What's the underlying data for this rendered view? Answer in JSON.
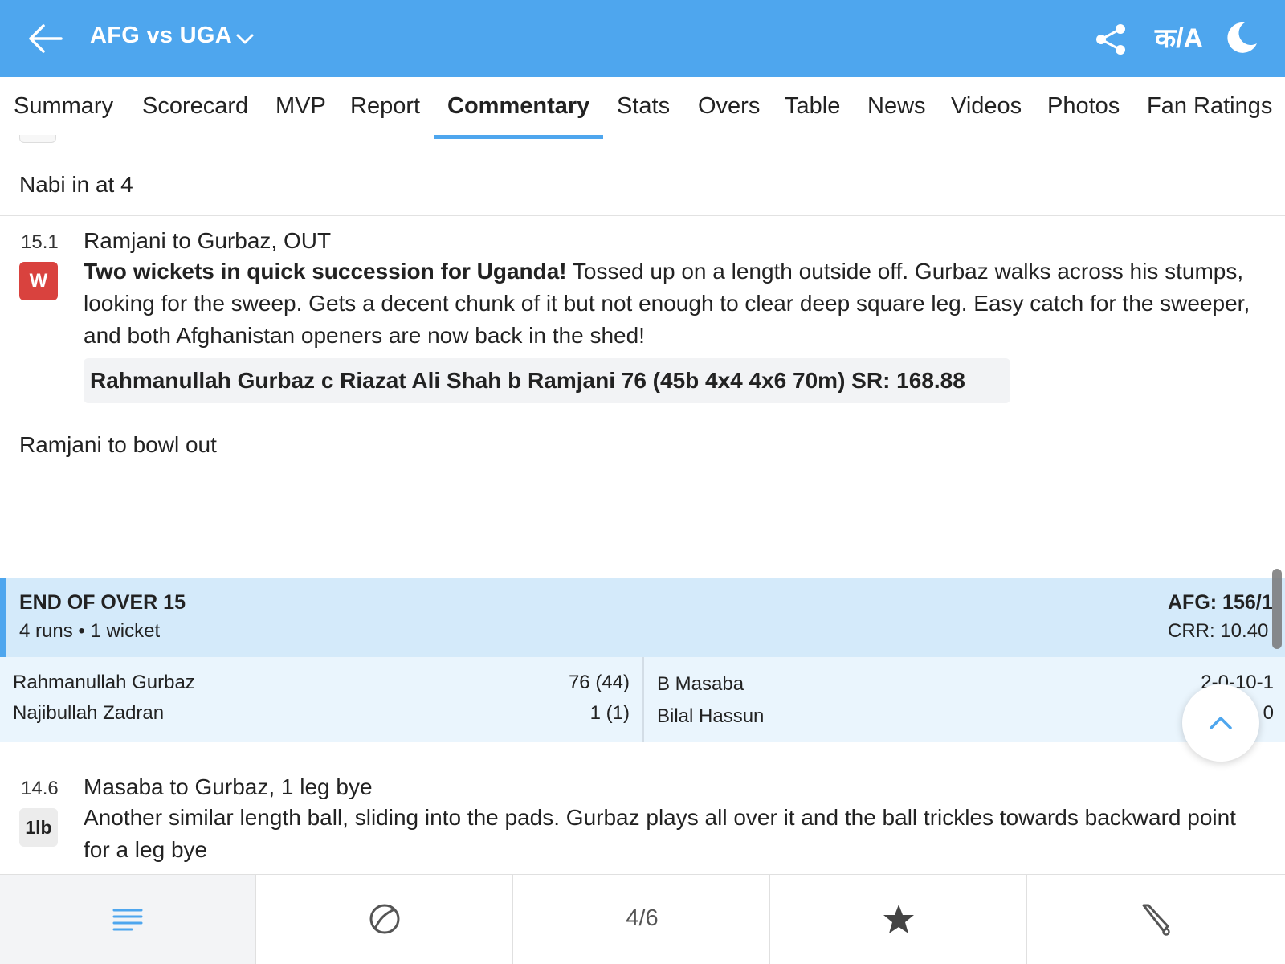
{
  "header": {
    "title": "AFG vs UGA",
    "lang_label": "क/A"
  },
  "tabs": [
    {
      "label": "Summary"
    },
    {
      "label": "Scorecard"
    },
    {
      "label": "MVP"
    },
    {
      "label": "Report"
    },
    {
      "label": "Commentary",
      "active": true
    },
    {
      "label": "Stats"
    },
    {
      "label": "Overs"
    },
    {
      "label": "Table"
    },
    {
      "label": "News"
    },
    {
      "label": "Videos"
    },
    {
      "label": "Photos"
    },
    {
      "label": "Fan Ratings"
    }
  ],
  "commentary": {
    "note_top": "Nabi in at 4",
    "ball_1": {
      "over": "15.1",
      "badge": "W",
      "headline": "Ramjani to Gurbaz, OUT",
      "bold_text": "Two wickets in quick succession for Uganda!",
      "text": " Tossed up on a length outside off. Gurbaz walks across his stumps, looking for the sweep. Gets a decent chunk of it but not enough to clear deep square leg. Easy catch for the sweeper, and both Afghanistan openers are now back in the shed!",
      "dismissal": "Rahmanullah Gurbaz c Riazat Ali Shah b Ramjani 76 (45b 4x4 4x6 70m) SR: 168.88"
    },
    "note_mid": "Ramjani to bowl out",
    "end_of_over": {
      "title": "END OF OVER 15",
      "summary": "4 runs • 1 wicket",
      "score": "AFG: 156/1",
      "crr": "CRR: 10.40",
      "batters": [
        {
          "name": "Rahmanullah Gurbaz",
          "score": "76 (44)"
        },
        {
          "name": "Najibullah Zadran",
          "score": "1 (1)"
        }
      ],
      "bowlers": [
        {
          "name": "B Masaba",
          "figures": "2-0-10-1"
        },
        {
          "name": "Bilal Hassun",
          "figures": "0"
        }
      ]
    },
    "ball_2": {
      "over": "14.6",
      "badge": "1lb",
      "headline": "Masaba to Gurbaz, 1 leg bye",
      "text": "Another similar length ball, sliding into the pads. Gurbaz plays all over it and the ball trickles towards backward point for a leg bye"
    }
  },
  "bottom_nav": {
    "items": [
      {
        "icon": "list-icon"
      },
      {
        "icon": "ball-icon"
      },
      {
        "label": "4/6"
      },
      {
        "icon": "star-icon"
      },
      {
        "icon": "bat-icon"
      }
    ]
  },
  "colors": {
    "header_bg": "#4ea6ee",
    "accent": "#4ea6ee",
    "wicket_badge": "#d9423e",
    "end_of_over_bg": "#d4eafa",
    "players_bg": "#eaf5fd"
  }
}
